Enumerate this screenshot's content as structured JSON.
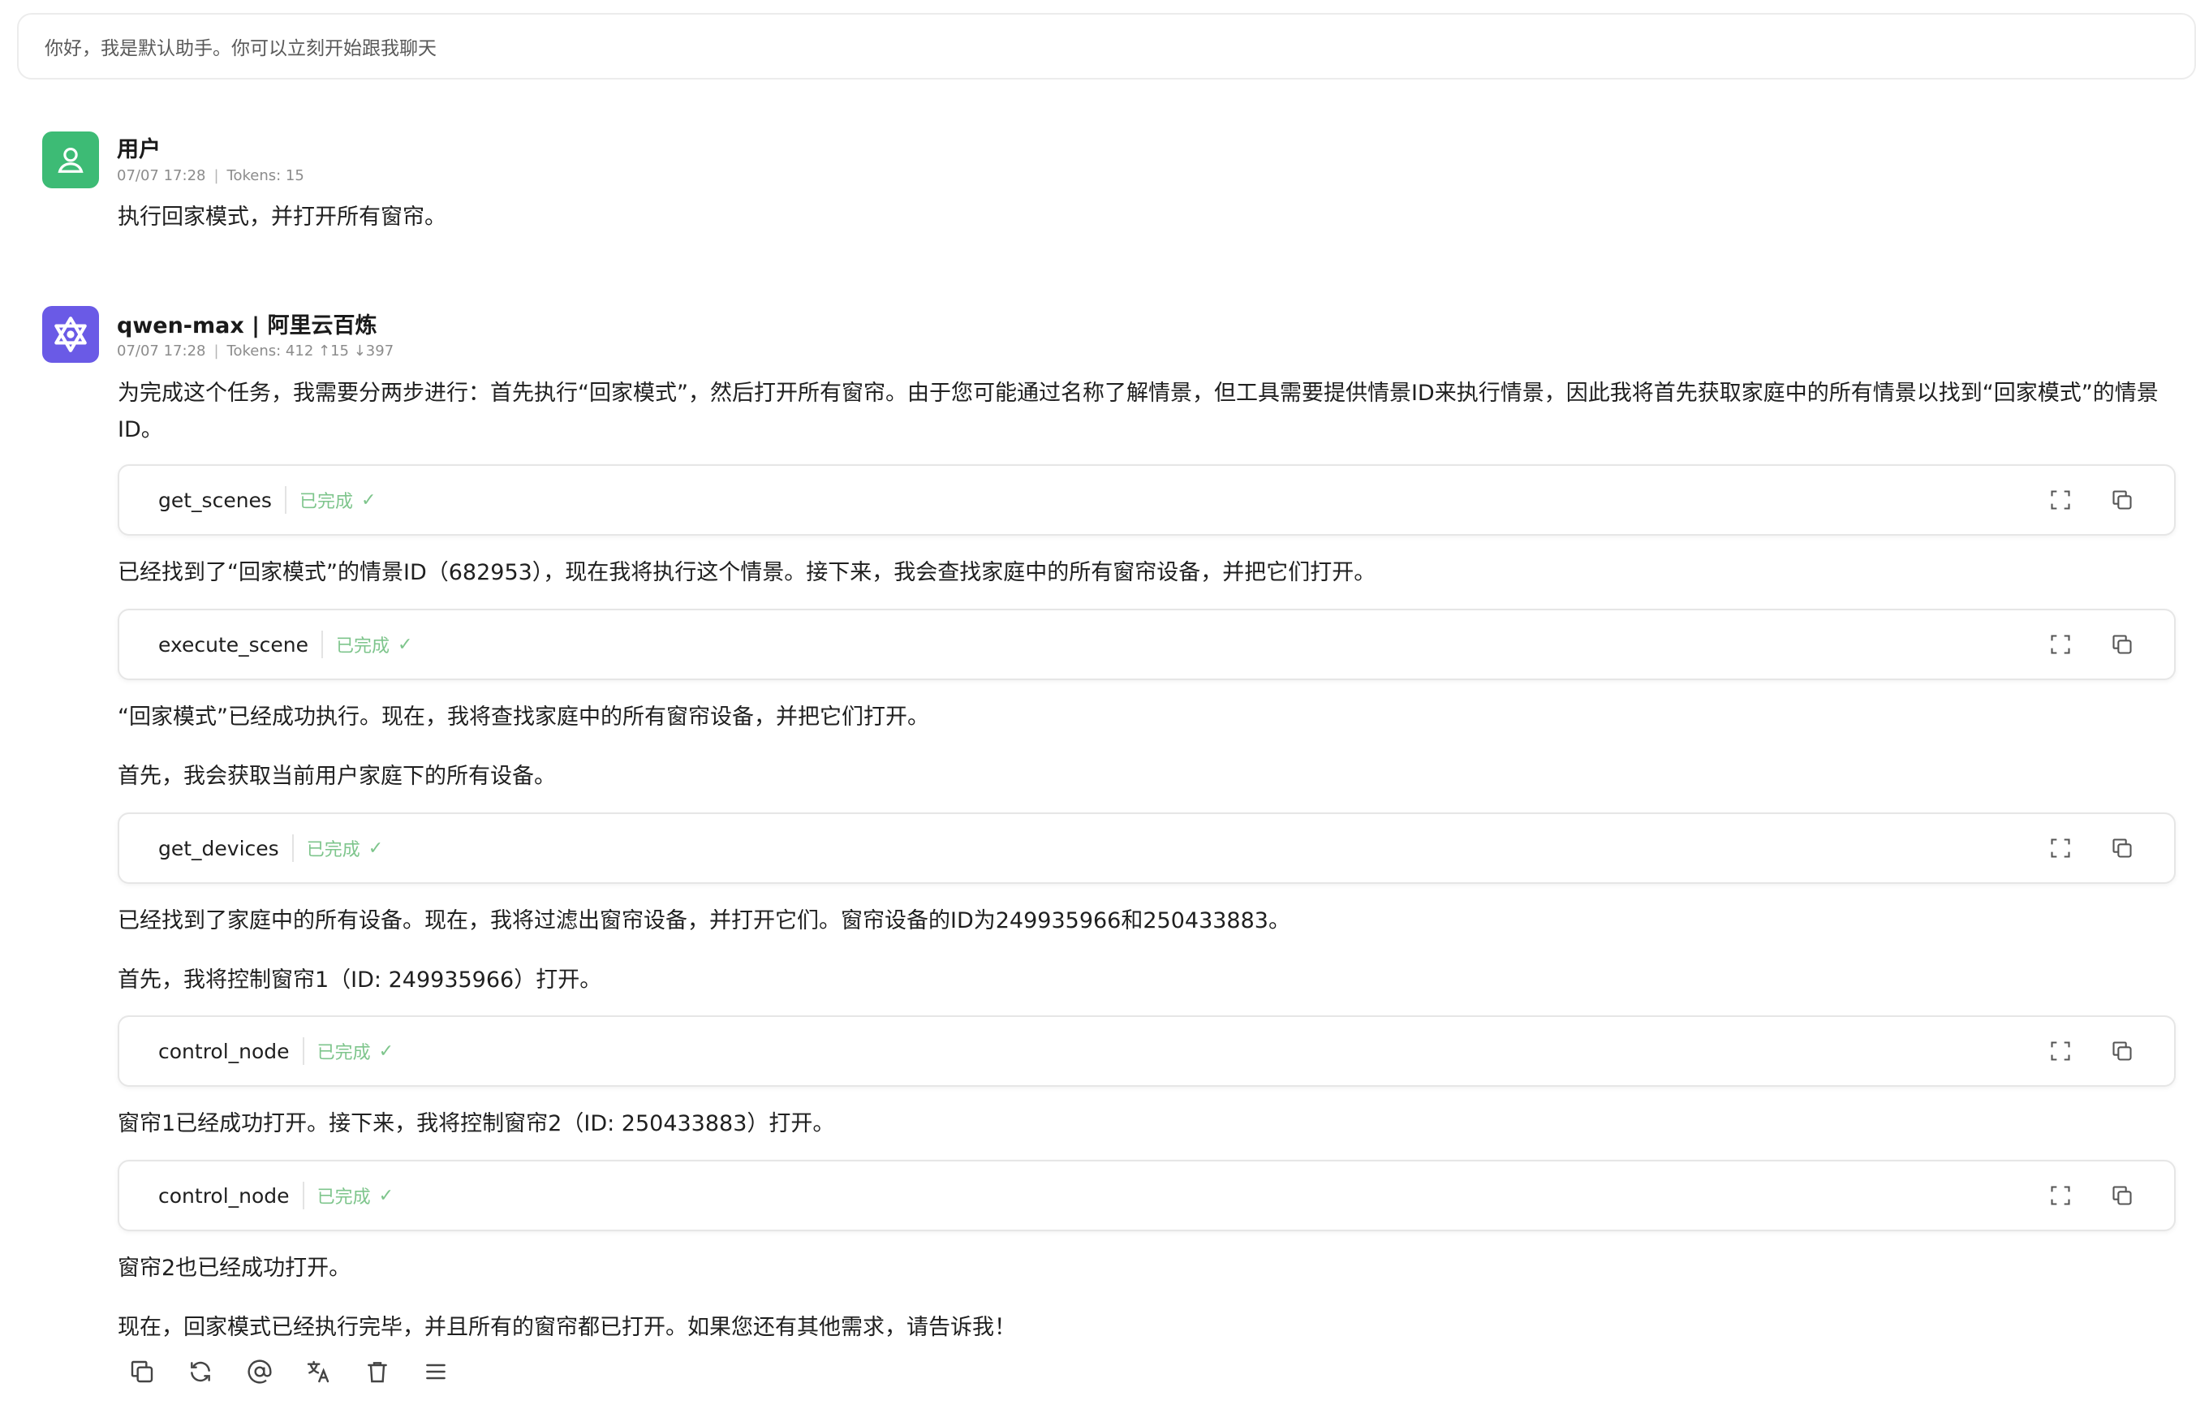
{
  "banner": {
    "text": "你好，我是默认助手。你可以立刻开始跟我聊天"
  },
  "user_message": {
    "name": "用户",
    "date": "07/07 17:28",
    "tokens": "Tokens: 15",
    "text": "执行回家模式，并打开所有窗帘。"
  },
  "assistant_message": {
    "name": "qwen-max | 阿里云百炼",
    "date": "07/07 17:28",
    "tokens": "Tokens: 412 ↑15 ↓397",
    "paragraphs": [
      "为完成这个任务，我需要分两步进行：首先执行“回家模式”，然后打开所有窗帘。由于您可能通过名称了解情景，但工具需要提供情景ID来执行情景，因此我将首先获取家庭中的所有情景以找到“回家模式”的情景ID。",
      "已经找到了“回家模式”的情景ID（682953），现在我将执行这个情景。接下来，我会查找家庭中的所有窗帘设备，并把它们打开。",
      "“回家模式”已经成功执行。现在，我将查找家庭中的所有窗帘设备，并把它们打开。",
      "首先，我会获取当前用户家庭下的所有设备。",
      "已经找到了家庭中的所有设备。现在，我将过滤出窗帘设备，并打开它们。窗帘设备的ID为249935966和250433883。",
      "首先，我将控制窗帘1（ID: 249935966）打开。",
      "窗帘1已经成功打开。接下来，我将控制窗帘2（ID: 250433883）打开。",
      "窗帘2也已经成功打开。",
      "现在，回家模式已经执行完毕，并且所有的窗帘都已打开。如果您还有其他需求，请告诉我！"
    ],
    "tools": [
      {
        "name": "get_scenes",
        "status": "已完成"
      },
      {
        "name": "execute_scene",
        "status": "已完成"
      },
      {
        "name": "get_devices",
        "status": "已完成"
      },
      {
        "name": "control_node",
        "status": "已完成"
      },
      {
        "name": "control_node",
        "status": "已完成"
      }
    ]
  },
  "icons": {
    "user_avatar": "user-icon",
    "bot_avatar": "qwen-logo-icon",
    "tool_expand": "expand-icon",
    "tool_copy": "copy-icon",
    "actions": [
      "copy-icon",
      "refresh-icon",
      "at-icon",
      "translate-icon",
      "trash-icon",
      "menu-icon"
    ]
  },
  "colors": {
    "user_avatar": "#3dbb75",
    "bot_avatar": "#6a5ae6",
    "status_done": "#7ec58c"
  }
}
